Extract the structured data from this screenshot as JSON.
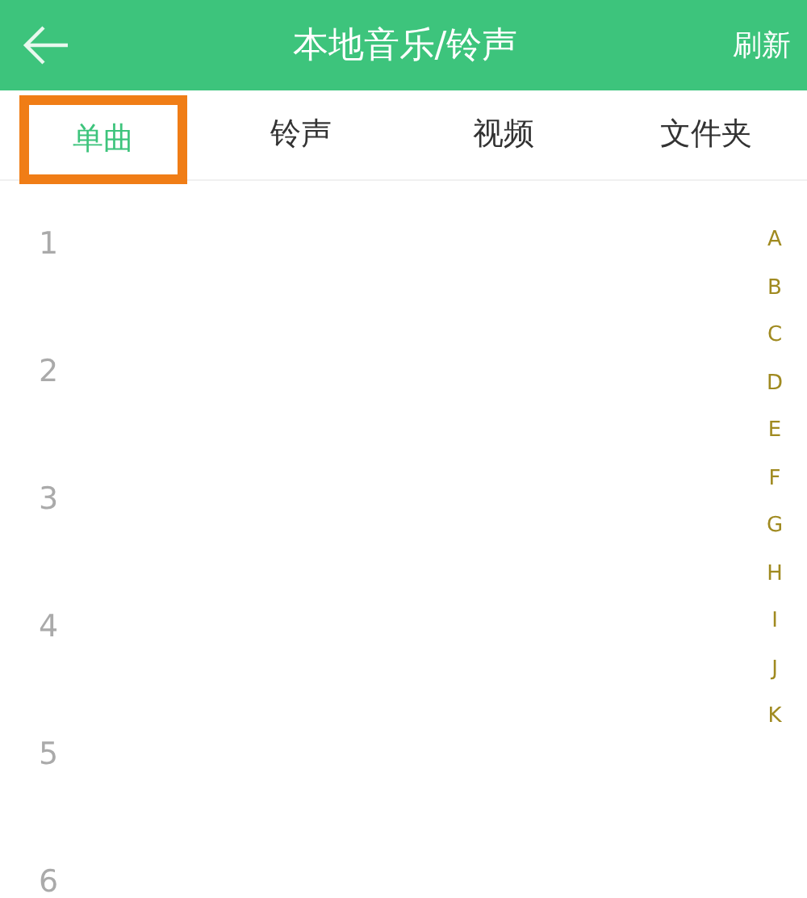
{
  "header": {
    "title": "本地音乐/铃声",
    "action": "刷新"
  },
  "tabs": [
    {
      "label": "单曲",
      "selected": true,
      "highlighted": true
    },
    {
      "label": "铃声",
      "selected": false,
      "highlighted": false
    },
    {
      "label": "视频",
      "selected": false,
      "highlighted": false
    },
    {
      "label": "文件夹",
      "selected": false,
      "highlighted": false
    }
  ],
  "rows": [
    "1",
    "2",
    "3",
    "4",
    "5",
    "6"
  ],
  "index": [
    "A",
    "B",
    "C",
    "D",
    "E",
    "F",
    "G",
    "H",
    "I",
    "J",
    "K"
  ]
}
